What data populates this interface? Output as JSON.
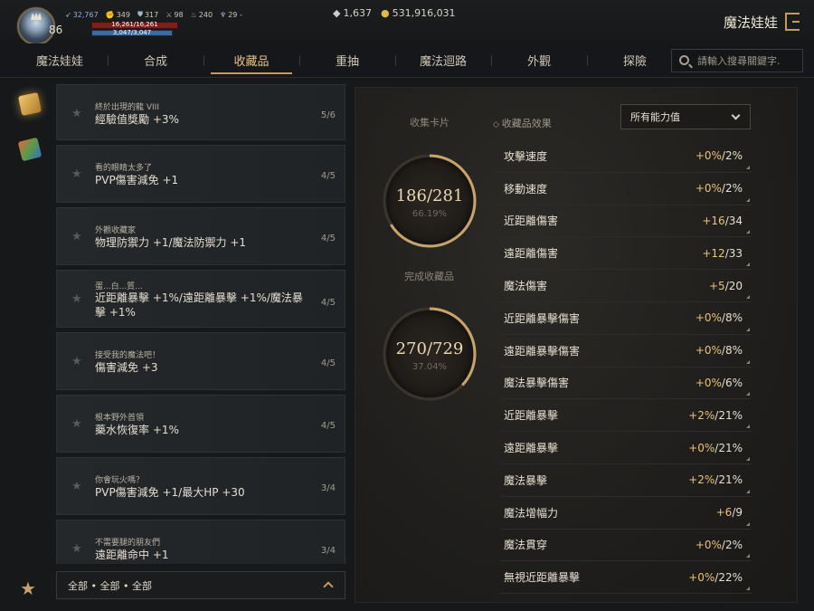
{
  "player": {
    "level": "86",
    "stats": [
      "32,767",
      "349",
      "317",
      "98",
      "240",
      "29 -"
    ],
    "hp": "16,261/16,261",
    "mp": "3,047/3,047"
  },
  "currency": {
    "diamonds": "1,637",
    "gold": "531,916,031"
  },
  "header": {
    "title": "魔法娃娃"
  },
  "tabs": [
    {
      "label": "魔法娃娃"
    },
    {
      "label": "合成"
    },
    {
      "label": "收藏品"
    },
    {
      "label": "重抽"
    },
    {
      "label": "魔法迴路"
    },
    {
      "label": "外觀"
    },
    {
      "label": "探險"
    }
  ],
  "active_tab": "收藏品",
  "search": {
    "placeholder": "請輸入搜尋關鍵字."
  },
  "collections": [
    {
      "name": "終於出現的龍 VIII",
      "effect": "經驗值獎勵 +3%",
      "count": "5/6"
    },
    {
      "name": "看的眼睛太多了",
      "effect": "PVP傷害減免 +1",
      "count": "4/5"
    },
    {
      "name": "外觀收藏家",
      "effect": "物理防禦力 +1/魔法防禦力 +1",
      "count": "4/5"
    },
    {
      "name": "蛋...白...質...",
      "effect": "近距離暴擊 +1%/遠距離暴擊 +1%/魔法暴擊 +1%",
      "count": "4/5"
    },
    {
      "name": "接受我的魔法吧！",
      "effect": "傷害減免 +3",
      "count": "4/5"
    },
    {
      "name": "根本野外首領",
      "effect": "藥水恢復率 +1%",
      "count": "4/5"
    },
    {
      "name": "你會玩火嗎？",
      "effect": "PVP傷害減免 +1/最大HP +30",
      "count": "3/4"
    },
    {
      "name": "不需要腿的朋友們",
      "effect": "遠距離命中 +1",
      "count": "3/4"
    }
  ],
  "filter": {
    "label": "全部 • 全部 • 全部"
  },
  "summary": {
    "cards_label": "收集卡片",
    "cards_value": "186/281",
    "cards_pct": "66.19%",
    "cards_fraction": 0.6619,
    "done_label": "完成收藏品",
    "done_value": "270/729",
    "done_pct": "37.04%",
    "done_fraction": 0.3704
  },
  "effects": {
    "title": "收藏品效果",
    "select": "所有能力值",
    "rows": [
      {
        "label": "攻擊速度",
        "value": "+0%/2%"
      },
      {
        "label": "移動速度",
        "value": "+0%/2%"
      },
      {
        "label": "近距離傷害",
        "value": "+16/34"
      },
      {
        "label": "遠距離傷害",
        "value": "+12/33"
      },
      {
        "label": "魔法傷害",
        "value": "+5/20"
      },
      {
        "label": "近距離暴擊傷害",
        "value": "+0%/8%"
      },
      {
        "label": "遠距離暴擊傷害",
        "value": "+0%/8%"
      },
      {
        "label": "魔法暴擊傷害",
        "value": "+0%/6%"
      },
      {
        "label": "近距離暴擊",
        "value": "+2%/21%"
      },
      {
        "label": "遠距離暴擊",
        "value": "+0%/21%"
      },
      {
        "label": "魔法暴擊",
        "value": "+2%/21%"
      },
      {
        "label": "魔法增幅力",
        "value": "+6/9"
      },
      {
        "label": "魔法貫穿",
        "value": "+0%/2%"
      },
      {
        "label": "無視近距離暴擊",
        "value": "+0%/22%"
      }
    ]
  },
  "colors": {
    "accent": "#c99a4e",
    "gold": "#e9c27a",
    "hp": "#7a1f1a",
    "mp": "#3b6aa0"
  }
}
